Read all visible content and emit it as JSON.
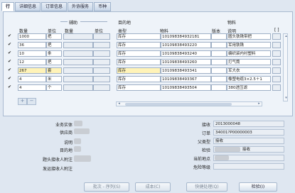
{
  "tabs": [
    "行",
    "详细信息",
    "订单信息",
    "外协服务",
    "币种"
  ],
  "grid": {
    "group_title": "辅助",
    "col_headers_left": [
      "数量",
      "单位",
      "数量",
      "单位"
    ],
    "dest_group_title": "目的地",
    "col_headers_mid": [
      "类型",
      "物料",
      "版本"
    ],
    "item_group_title": "物料",
    "col_header_desc": "说明",
    "col_header_flex": "[ ]",
    "rows": [
      {
        "checked": "✔",
        "qty": "1000",
        "unit": "把",
        "type": "库存",
        "item": "101098384932181",
        "desc": "圆头铁锹带把"
      },
      {
        "checked": "✔",
        "qty": "36",
        "unit": "把",
        "type": "库存",
        "item": "10109838493220",
        "desc": "军用铁锹"
      },
      {
        "checked": "✔",
        "qty": "10",
        "unit": "条",
        "type": "库存",
        "item": "10109838493240",
        "desc": "编织袋内衬塑料"
      },
      {
        "checked": "✔",
        "qty": "12",
        "unit": "把",
        "type": "库存",
        "item": "10109838493260",
        "desc": "打气筒"
      },
      {
        "checked": "✔",
        "qty": "267",
        "unit": "套",
        "type": "库存",
        "item": "10109838493341",
        "desc": "军大衣"
      },
      {
        "checked": "✔",
        "qty": "4",
        "unit": "米",
        "type": "库存",
        "item": "10109838493367",
        "desc": "橡塑电缆3×2.5＋1"
      },
      {
        "checked": "✔",
        "qty": "4",
        "unit": "个",
        "type": "库存",
        "item": "10109838493504",
        "desc": "380进压滤"
      }
    ],
    "add_button": "+",
    "remove_button": "−"
  },
  "form": {
    "left_labels": [
      "业务实体",
      "供应商",
      "说明",
      "目的地",
      "题头接收人附注",
      "发运接收人附注"
    ],
    "right_labels": [
      "接收",
      "订单",
      "父类型",
      "检验",
      "当前地点",
      "危险等级"
    ],
    "receipt_no": "2013000048",
    "order_no": "34001?P00000003",
    "parent_type": "接收",
    "inspection": "接收",
    "current_location": "",
    "hazard_class": ""
  },
  "buttons": {
    "prev": "批次 - 序列(S)",
    "cost": "成本(C)",
    "quick": "快捷处理(Q)",
    "inspect": "检验(I)"
  }
}
